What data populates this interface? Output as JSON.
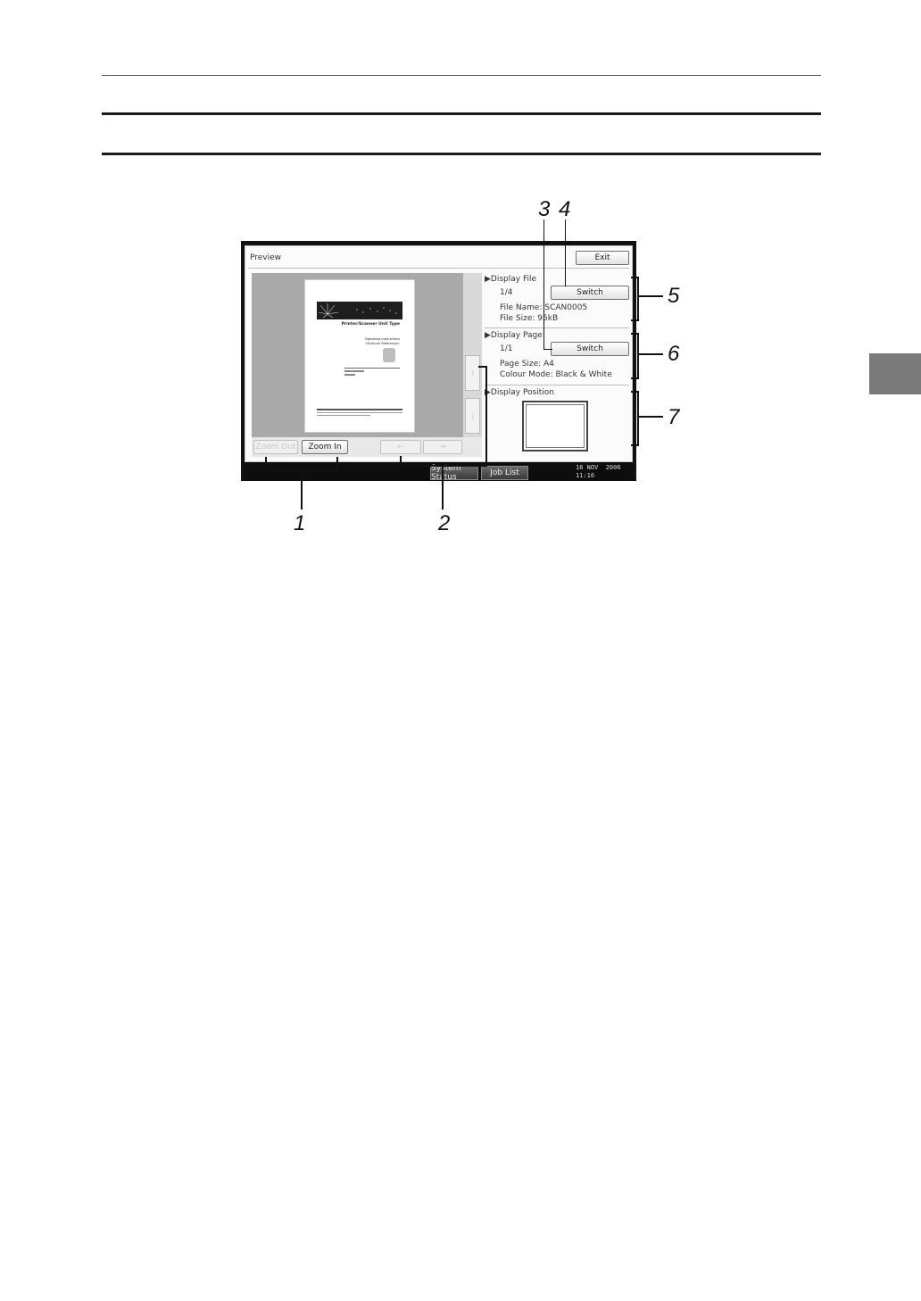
{
  "screen": {
    "title": "Preview",
    "exit_label": "Exit",
    "zoom_out_label": "Zoom Out",
    "zoom_in_label": "Zoom In",
    "left_arrow": "←",
    "right_arrow": "→",
    "up_arrow": "↑",
    "down_arrow": "↓",
    "display_file": {
      "heading": "Display File",
      "counter": "1/4",
      "switch_label": "Switch",
      "file_name": "File Name: SCAN0005",
      "file_size": "File Size: 95kB"
    },
    "display_page": {
      "heading": "Display Page",
      "counter": "1/1",
      "switch_label": "Switch",
      "page_size": "Page Size: A4",
      "colour_mode": "Colour Mode: Black & White"
    },
    "display_position": {
      "heading": "Display Position"
    },
    "status_bar": {
      "system_status_label": "System Status",
      "job_list_label": "Job List",
      "date": "16 NOV  2006",
      "time": "11:16"
    }
  },
  "thumbnail": {
    "title": "Printer/Scanner Unit Type",
    "subtitle_1": "Operating Instructions",
    "subtitle_2": "<Scanner Reference>"
  },
  "callouts": {
    "c1": "1",
    "c2": "2",
    "c3": "3",
    "c4": "4",
    "c5": "5",
    "c6": "6",
    "c7": "7"
  }
}
